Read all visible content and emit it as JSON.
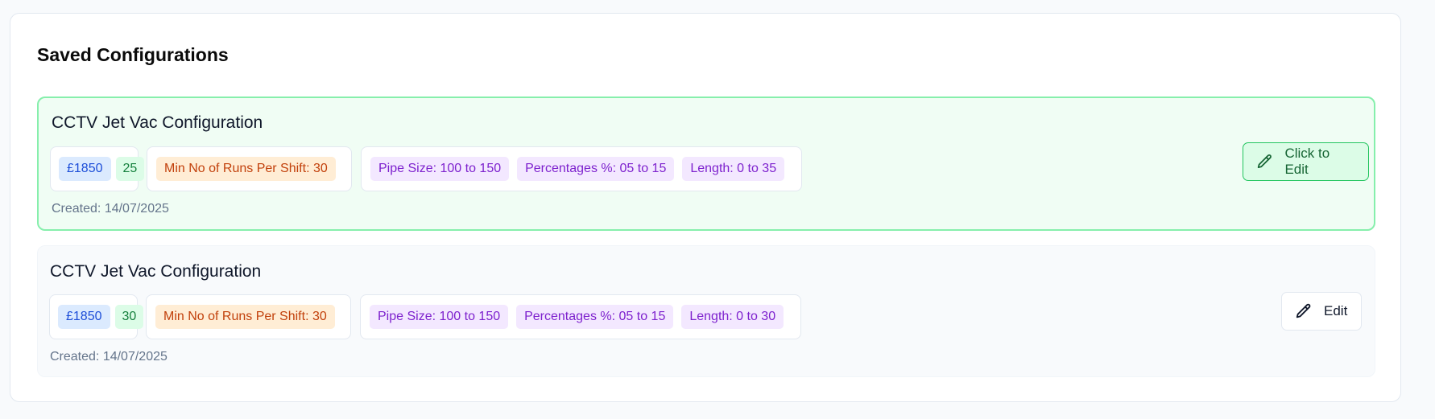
{
  "panel": {
    "title": "Saved Configurations"
  },
  "configs": [
    {
      "title": "CCTV Jet Vac Configuration",
      "price": "£1850",
      "count": "25",
      "runs": "Min No of Runs Per Shift: 30",
      "pipe_size": "Pipe Size: 100 to 150",
      "percentages": "Percentages %: 05 to 15",
      "length": "Length: 0 to 35",
      "created": "Created: 14/07/2025",
      "button_label": "Click to Edit",
      "button_icon": "pencil-icon"
    },
    {
      "title": "CCTV Jet Vac Configuration",
      "price": "£1850",
      "count": "30",
      "runs": "Min No of Runs Per Shift: 30",
      "pipe_size": "Pipe Size: 100 to 150",
      "percentages": "Percentages %: 05 to 15",
      "length": "Length: 0 to 30",
      "created": "Created: 14/07/2025",
      "button_label": "Edit",
      "button_icon": "pencil-icon"
    }
  ],
  "colors": {
    "active_card_bg": "#f0fdf4",
    "active_card_border": "#86efac",
    "price_chip": "#dbeafe",
    "count_chip": "#dcfce7",
    "runs_chip": "#ffedd5",
    "range_chip": "#f3e8ff"
  }
}
